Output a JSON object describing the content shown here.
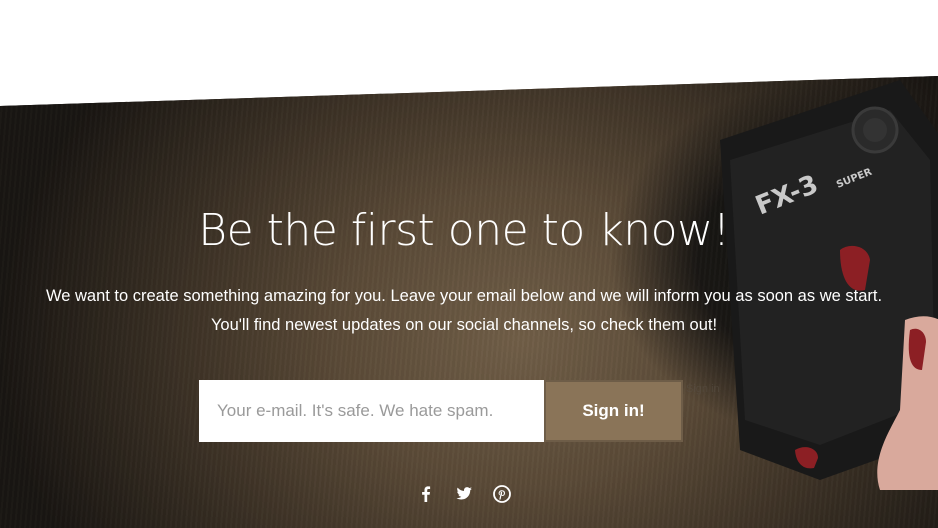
{
  "hero": {
    "headline": "Be the first one to know!",
    "subtitle_line1": "We want to create something amazing for you. Leave your email below and we will inform you as soon as we start.",
    "subtitle_line2": "You'll find newest updates on our social channels, so check them out!"
  },
  "signup": {
    "email_placeholder": "Your e-mail. It's safe. We hate spam.",
    "submit_label": "Sign in!",
    "ghost_label": "Sign in"
  },
  "camera": {
    "model_text": "FX-3",
    "badge_text": "SUPER"
  },
  "social": {
    "icons": [
      "facebook-icon",
      "twitter-icon",
      "pinterest-icon"
    ]
  },
  "colors": {
    "accent": "#8a7458",
    "text": "#ffffff",
    "input_bg": "#ffffff"
  }
}
